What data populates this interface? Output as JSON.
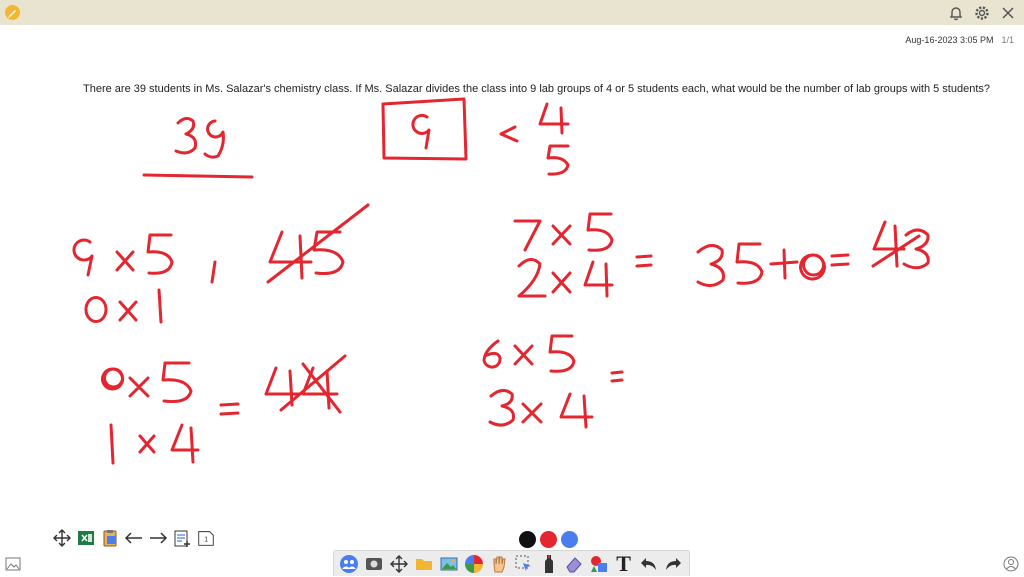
{
  "header": {
    "app_icon": "pencil-icon",
    "right_icons": [
      "bell-icon",
      "gear-icon",
      "close-icon"
    ]
  },
  "page_stamp": {
    "datetime": "Aug-16-2023 3:05 PM",
    "page": "1/1"
  },
  "question": {
    "text": "There are 39 students in Ms. Salazar's chemistry class. If Ms. Salazar divides the class into 9 lab groups of 4 or 5 students each, what would be the number of lab groups with 5 students?"
  },
  "handwriting": {
    "color": "#e3262f",
    "lines": [
      "39",
      "9",
      "4",
      "5",
      "9x5",
      "0x1",
      "45",
      "8x5",
      "1x4",
      "=",
      "44",
      "7x5",
      "2x4",
      "=",
      "35+8",
      "=",
      "43",
      "6x5",
      "3x4",
      "="
    ]
  },
  "left_tools": [
    "move-icon",
    "excel-icon",
    "clipboard-icon",
    "arrow-left-icon",
    "arrow-right-icon",
    "add-page-icon",
    "page-icon"
  ],
  "palette": {
    "colors": [
      "#111111",
      "#e3262f",
      "#4a7df0"
    ]
  },
  "toolbar": {
    "tools": [
      "people-icon",
      "camera-icon",
      "move-icon",
      "folder-icon",
      "image-icon",
      "color-wheel-icon",
      "hand-icon",
      "select-icon",
      "marker-icon",
      "eraser-icon",
      "shapes-icon",
      "text-icon",
      "undo-icon",
      "redo-icon"
    ],
    "text_tool_label": "T"
  },
  "corners": {
    "left": "image-icon",
    "right": "user-icon"
  }
}
